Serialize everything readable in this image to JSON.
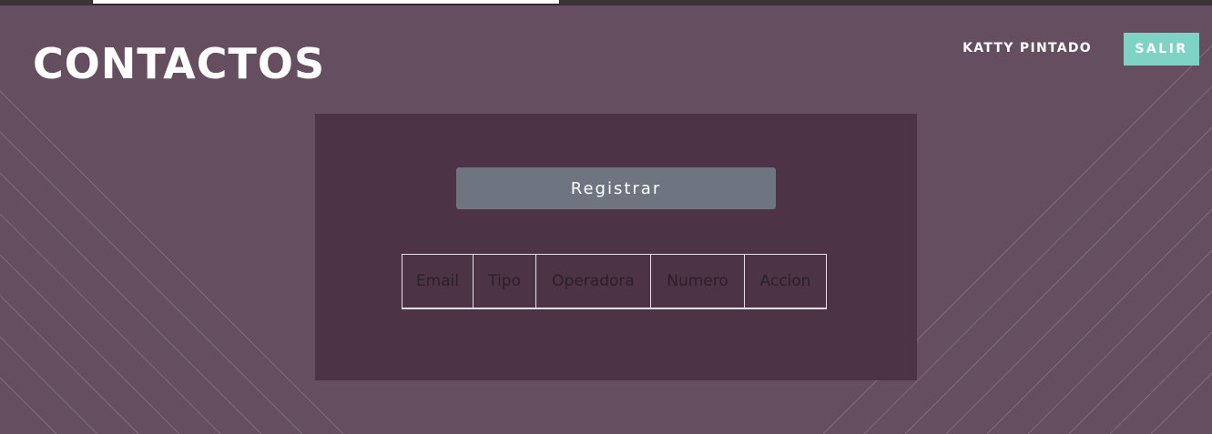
{
  "header": {
    "title": "CONTACTOS",
    "user_name": "KATTY PINTADO",
    "logout_label": "SALIR"
  },
  "panel": {
    "register_label": "Registrar",
    "table": {
      "columns": [
        "Email",
        "Tipo",
        "Operadora",
        "Numero",
        "Accion"
      ],
      "rows": []
    }
  },
  "colors": {
    "background": "#644e5f",
    "panel": "#4c3346",
    "accent": "#7fd3c4",
    "register_button": "#6f7580"
  }
}
